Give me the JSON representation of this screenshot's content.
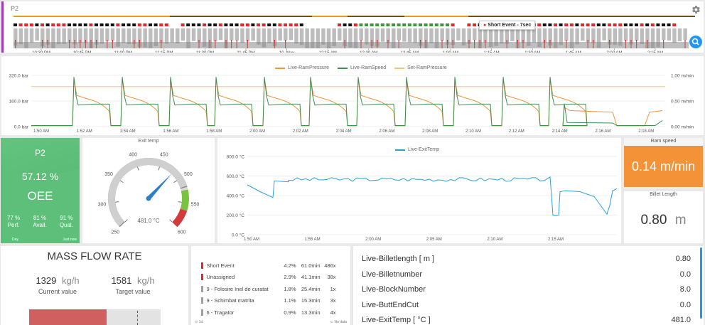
{
  "timeline": {
    "title": "P2",
    "settings_icon": "gear-icon",
    "search_icon": "search-icon",
    "tooltip": "Short Event - 7sec",
    "times": [
      "10:30 PM",
      "10:45 PM",
      "11:00 PM",
      "11:15 PM",
      "11:30 PM",
      "11:45 PM",
      "10. May",
      "12:15 AM",
      "12:30 AM",
      "12:45 AM",
      "1:00 AM",
      "1:15 AM",
      "1:30 AM",
      "1:45 AM",
      "2:00 AM",
      "2:15 AM"
    ],
    "colors": {
      "orange": "#e69a1f",
      "brown": "#7a4a12",
      "red": "#e5262a",
      "black": "#111111",
      "green": "#3a9a3a",
      "gray": "#bdbdbd",
      "darkgray": "#8a8a8a",
      "accent": "#2196f3"
    }
  },
  "ram_chart": {
    "chart_data": {
      "type": "line",
      "legend_placement": "top-center",
      "series": [
        {
          "name": "Live-RamPressure",
          "color": "#f39237"
        },
        {
          "name": "Live-RamSpeed",
          "color": "#3e8e50"
        },
        {
          "name": "Set-RamPressure",
          "color": "#f5c27a"
        }
      ],
      "yleft_ticks": [
        "320.0 bar",
        "160.0 bar",
        "0.0 bar"
      ],
      "yright_ticks": [
        "1.00 m/min",
        "0.50 m/min",
        "0.00 m/min"
      ],
      "x_ticks": [
        "1:50 AM",
        "1:52 AM",
        "1:54 AM",
        "1:56 AM",
        "1:58 AM",
        "2:00 AM",
        "2:02 AM",
        "2:04 AM",
        "2:06 AM",
        "2:08 AM",
        "2:10 AM",
        "2:12 AM",
        "2:14 AM",
        "2:16 AM",
        "2:18 AM"
      ],
      "ylim_left": [
        0,
        320
      ],
      "ylim_right": [
        0,
        1
      ],
      "set_pressure": 250
    }
  },
  "oee": {
    "machine": "P2",
    "value": "57.12 %",
    "label": "OEE",
    "perf_value": "77 %",
    "perf_label": "Perf.",
    "avail_value": "81 %",
    "avail_label": "Avail.",
    "qual_value": "91 %",
    "qual_label": "Qual.",
    "footer_left": "Day",
    "footer_right": "Just now",
    "color": "#5dbf79"
  },
  "gauge": {
    "title": "Exit temp",
    "value_text": "481.0 °C",
    "value": 481,
    "min": 250,
    "max": 600,
    "ticks": [
      "250",
      "300",
      "350",
      "400",
      "450",
      "500",
      "550",
      "600"
    ],
    "needle_color": "#2f7fc8"
  },
  "exit_chart": {
    "chart_data": {
      "type": "line",
      "series": [
        {
          "name": "Live-ExitTemp",
          "color": "#2a9fd6"
        }
      ],
      "y_ticks": [
        "800.0 °C",
        "600.0 °C",
        "400.0 °C",
        "200.0 °C",
        "0.0 °C"
      ],
      "x_ticks": [
        "1:50 AM",
        "1:55 AM",
        "2:00 AM",
        "2:05 AM",
        "2:10 AM",
        "2:15 AM"
      ],
      "ylim": [
        0,
        800
      ]
    }
  },
  "ram_speed": {
    "title": "Ram speed",
    "value": "0.14",
    "unit": "m/min",
    "color": "#f39237"
  },
  "billet": {
    "title": "Billet Length",
    "value": "0.80",
    "unit": "m"
  },
  "mass_flow": {
    "title": "MASS FLOW RATE",
    "current_value": "1329",
    "current_unit": "kg/h",
    "current_label": "Current value",
    "target_value": "1581",
    "target_unit": "kg/h",
    "target_label": "Target value",
    "ratio": 0.84,
    "bar_color": "#d06060"
  },
  "events": {
    "rows": [
      {
        "color": "#e5262a",
        "name": "Short Event",
        "pct": "4.2%",
        "dur": "61.0min",
        "count": "486x"
      },
      {
        "color": "#e5262a",
        "name": "Unassigned",
        "pct": "2.9%",
        "dur": "41.1min",
        "count": "38x"
      },
      {
        "color": "#9e9e9e",
        "name": "9 - Folosire Inel de curatat",
        "pct": "1.8%",
        "dur": "25.4min",
        "count": "1x"
      },
      {
        "color": "#9e9e9e",
        "name": "9 - Schimbat matrita",
        "pct": "1.1%",
        "dur": "15.3min",
        "count": "3x"
      },
      {
        "color": "#9e9e9e",
        "name": "6 - Tragator",
        "pct": "0.9%",
        "dur": "13.3min",
        "count": "4x"
      }
    ],
    "footer_left": "1d",
    "footer_right": "No data"
  },
  "values_list": {
    "rows": [
      {
        "name": "Live-Billetlength  [ m ]",
        "value": "0.80"
      },
      {
        "name": "Live-Billetnumber",
        "value": "0.0"
      },
      {
        "name": "Live-BlockNumber",
        "value": "8.0"
      },
      {
        "name": "Live-ButtEndCut",
        "value": "0.0"
      },
      {
        "name": "Live-ExitTemp  [ °C ]",
        "value": "481.0"
      }
    ]
  }
}
